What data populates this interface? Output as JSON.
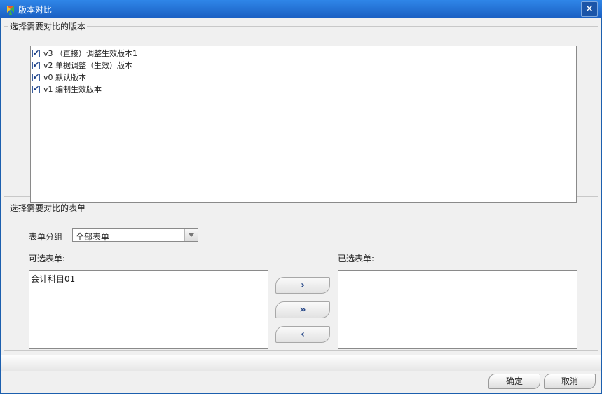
{
  "window": {
    "title": "版本对比",
    "close_glyph": "✕"
  },
  "versions": {
    "legend": "选择需要对比的版本",
    "items": [
      {
        "label": "v3 （直接）调整生效版本1",
        "checked": true
      },
      {
        "label": "v2 单据调整（生效）版本",
        "checked": true
      },
      {
        "label": "v0 默认版本",
        "checked": true
      },
      {
        "label": "v1 编制生效版本",
        "checked": true
      }
    ]
  },
  "forms": {
    "legend": "选择需要对比的表单",
    "group_label": "表单分组",
    "group_value": "全部表单",
    "available_label": "可选表单:",
    "selected_label": "已选表单:",
    "available_items": [
      "会计科目01"
    ],
    "selected_items": [],
    "move_right": "›",
    "move_all_right": "»",
    "move_left": "‹"
  },
  "buttons": {
    "ok": "确定",
    "cancel": "取消"
  }
}
